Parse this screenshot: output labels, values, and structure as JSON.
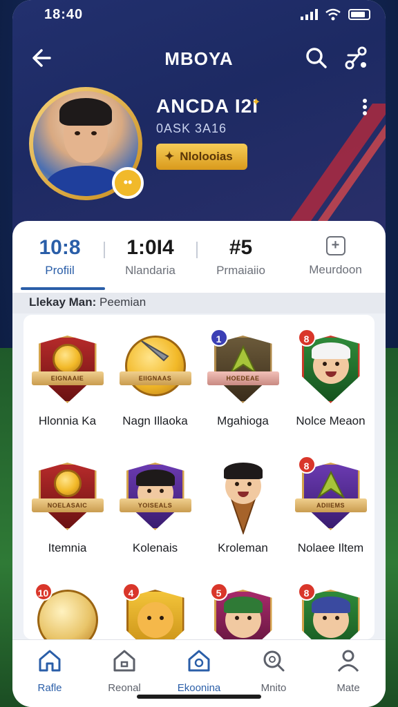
{
  "status_bar": {
    "time": "18:40"
  },
  "header": {
    "title": "MBOYA"
  },
  "profile": {
    "username": "ANCDA I2I",
    "subtitle": "0ASK 3A16",
    "level_badge": "Nlolooias",
    "avatar_badge": "••"
  },
  "stats": [
    {
      "value": "10:8",
      "label": "Profiil"
    },
    {
      "value": "1:0I4",
      "label": "Nlandaria"
    },
    {
      "value": "#5",
      "label": "Prmaiaiio"
    },
    {
      "value": "",
      "label": "Meurdoon"
    }
  ],
  "section": {
    "title": "Llekay Man:",
    "subtitle": "Peemian"
  },
  "items": [
    {
      "label": "Hlonnia Ka",
      "ribbon": "EIGNAAIE",
      "badge": ""
    },
    {
      "label": "Nagn Illaoka",
      "ribbon": "EIIGNAAS",
      "badge": ""
    },
    {
      "label": "Mgahioga",
      "ribbon": "HOEDEAE",
      "badge": "1"
    },
    {
      "label": "Nolce Meaon",
      "ribbon": "",
      "badge": "8"
    },
    {
      "label": "Itemnia",
      "ribbon": "NOELASAIC",
      "badge": ""
    },
    {
      "label": "Kolenais",
      "ribbon": "YOISEALS",
      "badge": ""
    },
    {
      "label": "Kroleman",
      "ribbon": "",
      "badge": ""
    },
    {
      "label": "Nolaee Iltem",
      "ribbon": "ADIIEMS",
      "badge": "8"
    },
    {
      "label": "",
      "ribbon": "",
      "badge": "10"
    },
    {
      "label": "",
      "ribbon": "",
      "badge": "4"
    },
    {
      "label": "",
      "ribbon": "",
      "badge": "5"
    },
    {
      "label": "",
      "ribbon": "",
      "badge": "8"
    }
  ],
  "bottom_nav": [
    {
      "label": "Rafle",
      "icon": "home-icon"
    },
    {
      "label": "Reonal",
      "icon": "house-icon"
    },
    {
      "label": "Ekoonina",
      "icon": "badge-icon"
    },
    {
      "label": "Mnito",
      "icon": "search-icon"
    },
    {
      "label": "Mate",
      "icon": "person-icon"
    }
  ],
  "colors": {
    "accent": "#2a5ea8",
    "header_bg": "#22306e",
    "gold": "#f1b92a"
  }
}
